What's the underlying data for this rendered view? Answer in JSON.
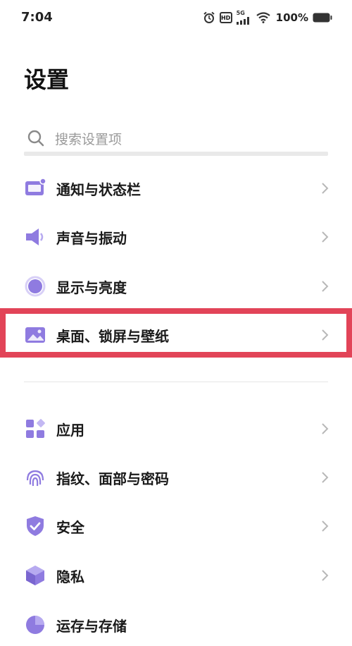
{
  "status_bar": {
    "time": "7:04",
    "network": "5G",
    "hd": "HD",
    "battery_percent": "100%"
  },
  "page": {
    "title": "设置"
  },
  "search": {
    "placeholder": "搜索设置项"
  },
  "menu": {
    "items": [
      {
        "label": "通知与状态栏",
        "icon": "notification-bar-icon"
      },
      {
        "label": "声音与振动",
        "icon": "speaker-icon"
      },
      {
        "label": "显示与亮度",
        "icon": "brightness-icon"
      },
      {
        "label": "桌面、锁屏与壁纸",
        "icon": "wallpaper-icon",
        "highlighted": true
      },
      {
        "label": "应用",
        "icon": "apps-icon"
      },
      {
        "label": "指纹、面部与密码",
        "icon": "fingerprint-icon"
      },
      {
        "label": "安全",
        "icon": "shield-icon"
      },
      {
        "label": "隐私",
        "icon": "privacy-icon"
      },
      {
        "label": "运存与存储",
        "icon": "storage-icon"
      }
    ]
  },
  "colors": {
    "accent": "#8f7be0",
    "highlight_border": "#e24458",
    "chevron": "#b8b8b8"
  }
}
